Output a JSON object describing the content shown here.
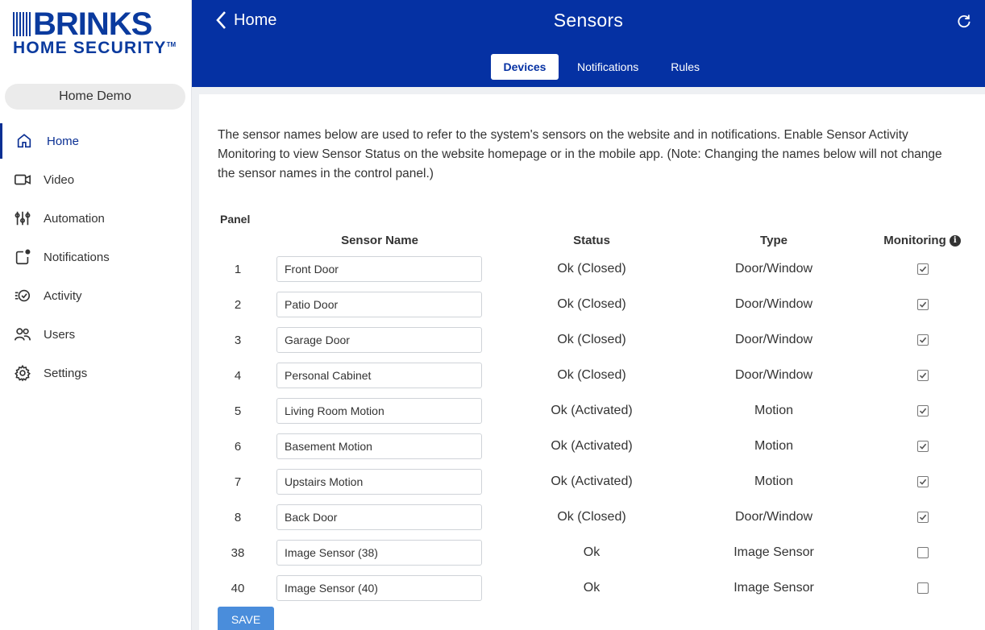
{
  "brand": {
    "logo_word": "BRINKS",
    "logo_sub": "HOME SECURITY",
    "logo_tm": "TM",
    "colors": {
      "primary": "#0531a3",
      "header_bg": "#0531a3",
      "save_button": "#4a8ddb"
    }
  },
  "account": {
    "name": "Home Demo"
  },
  "nav": {
    "items": [
      {
        "label": "Home",
        "icon": "home-icon",
        "active": true
      },
      {
        "label": "Video",
        "icon": "video-camera-icon"
      },
      {
        "label": "Automation",
        "icon": "sliders-icon"
      },
      {
        "label": "Notifications",
        "icon": "notification-icon"
      },
      {
        "label": "Activity",
        "icon": "activity-icon"
      },
      {
        "label": "Users",
        "icon": "users-icon"
      },
      {
        "label": "Settings",
        "icon": "gear-icon"
      }
    ]
  },
  "header": {
    "back_label": "Home",
    "title": "Sensors",
    "tabs": [
      {
        "label": "Devices",
        "active": true
      },
      {
        "label": "Notifications"
      },
      {
        "label": "Rules"
      }
    ]
  },
  "content": {
    "intro": "The sensor names below are used to refer to the system's sensors on the website and in notifications. Enable Sensor Activity Monitoring to view Sensor Status on the website homepage or in the mobile app. (Note: Changing the names below will not change the sensor names in the control panel.)",
    "panel_label": "Panel",
    "columns": {
      "name": "Sensor Name",
      "status": "Status",
      "type": "Type",
      "monitoring": "Monitoring"
    },
    "sensors": [
      {
        "panel": "1",
        "name": "Front Door",
        "status": "Ok (Closed)",
        "type": "Door/Window",
        "monitoring": true
      },
      {
        "panel": "2",
        "name": "Patio Door",
        "status": "Ok (Closed)",
        "type": "Door/Window",
        "monitoring": true
      },
      {
        "panel": "3",
        "name": "Garage Door",
        "status": "Ok (Closed)",
        "type": "Door/Window",
        "monitoring": true
      },
      {
        "panel": "4",
        "name": "Personal Cabinet",
        "status": "Ok (Closed)",
        "type": "Door/Window",
        "monitoring": true
      },
      {
        "panel": "5",
        "name": "Living Room Motion",
        "status": "Ok (Activated)",
        "type": "Motion",
        "monitoring": true
      },
      {
        "panel": "6",
        "name": "Basement Motion",
        "status": "Ok (Activated)",
        "type": "Motion",
        "monitoring": true
      },
      {
        "panel": "7",
        "name": "Upstairs Motion",
        "status": "Ok (Activated)",
        "type": "Motion",
        "monitoring": true
      },
      {
        "panel": "8",
        "name": "Back Door",
        "status": "Ok (Closed)",
        "type": "Door/Window",
        "monitoring": true
      },
      {
        "panel": "38",
        "name": "Image Sensor (38)",
        "status": "Ok",
        "type": "Image Sensor",
        "monitoring": false
      },
      {
        "panel": "40",
        "name": "Image Sensor (40)",
        "status": "Ok",
        "type": "Image Sensor",
        "monitoring": false
      }
    ],
    "save_label": "SAVE"
  }
}
